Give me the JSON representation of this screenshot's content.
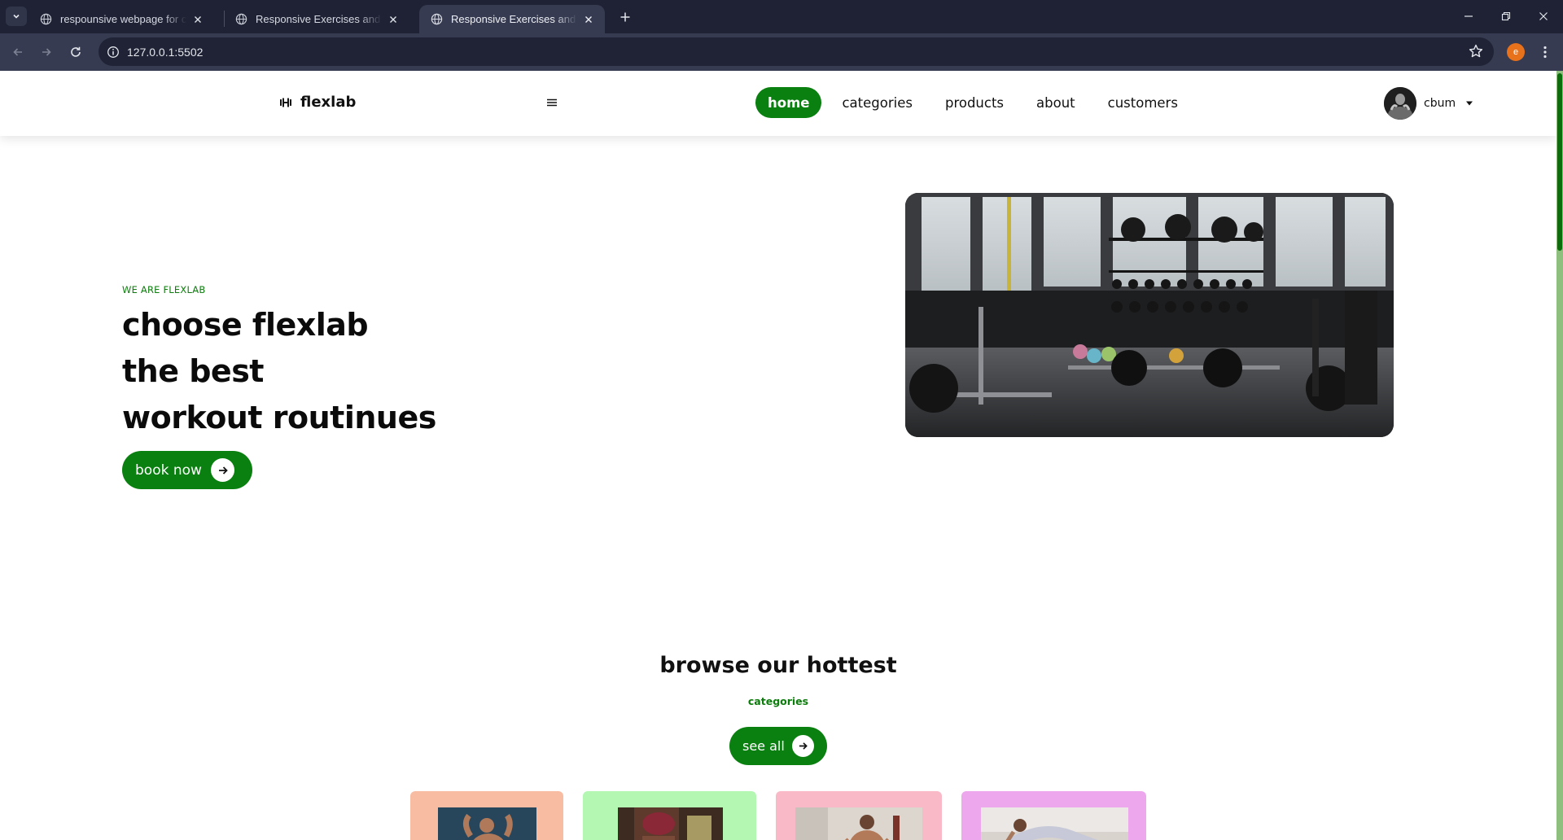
{
  "browser": {
    "tabs": [
      {
        "title": "respounsive webpage for cloud",
        "active": false
      },
      {
        "title": "Responsive Exercises and Workouts",
        "active": false
      },
      {
        "title": "Responsive Exercises and Workouts",
        "active": true
      }
    ],
    "url": "127.0.0.1:5502",
    "profile_initial": "e",
    "colors": {
      "frame": "#1e2234",
      "toolbar": "#363b51",
      "profile": "#e8711b"
    }
  },
  "header": {
    "brand": "flexlab",
    "nav": [
      {
        "label": "home",
        "active": true
      },
      {
        "label": "categories",
        "active": false
      },
      {
        "label": "products",
        "active": false
      },
      {
        "label": "about",
        "active": false
      },
      {
        "label": "customers",
        "active": false
      }
    ],
    "user": {
      "name": "cbum"
    }
  },
  "hero": {
    "eyebrow": "WE ARE FLEXLAB",
    "title_lines": [
      "choose flexlab",
      "the best",
      "workout routinues"
    ],
    "cta": "book now",
    "image": "gym interior with dumbbell racks"
  },
  "categories": {
    "title": "browse our hottest",
    "subtitle": "categories",
    "cta": "see all",
    "cards": [
      {
        "color": "#f8bca2"
      },
      {
        "color": "#b3f7b3"
      },
      {
        "color": "#f9b9c6"
      },
      {
        "color": "#eda8ed"
      }
    ]
  },
  "theme": {
    "accent": "#0a8010"
  }
}
